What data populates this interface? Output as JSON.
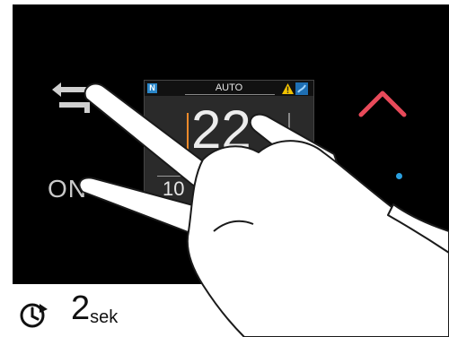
{
  "display": {
    "mode": "AUTO",
    "badge": "N",
    "temperature": "22",
    "degree": "°",
    "secondary": "10"
  },
  "buttons": {
    "on_label": "ON"
  },
  "instruction": {
    "duration_value": "2",
    "duration_unit": "sek"
  },
  "icons": [
    "back-arrow-icon",
    "chevron-up-icon",
    "warning-icon",
    "fan-icon",
    "press-hold-timer-icon",
    "hand-icon"
  ],
  "colors": {
    "panel_bg": "#000000",
    "up_arrow": "#e84a5a",
    "indicator_dot": "#2aa0e0",
    "badge_bg": "#2a86c8",
    "warning": "#f2c200",
    "temp_bar_accent": "#f08a2a"
  }
}
